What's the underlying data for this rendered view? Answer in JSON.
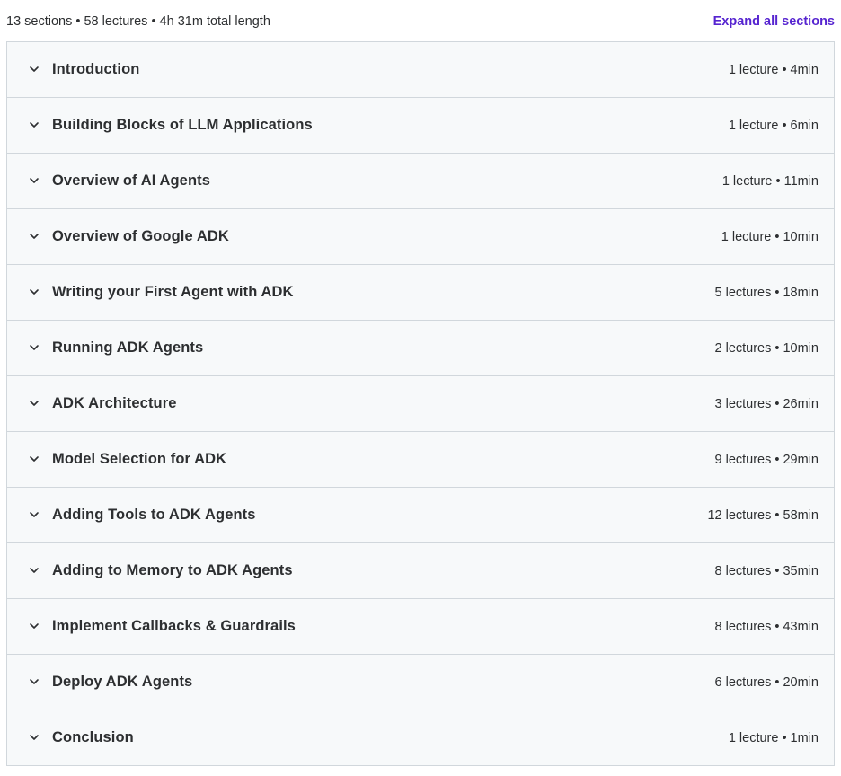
{
  "header": {
    "summary": "13 sections • 58 lectures • 4h 31m total length",
    "expand_label": "Expand all sections"
  },
  "icons": {
    "section_toggle": "chevron-down-icon"
  },
  "colors": {
    "accent": "#5624d0",
    "row_background": "#f7f9fa",
    "border": "#d1d7dc",
    "text": "#2d2f31"
  },
  "sections": [
    {
      "title": "Introduction",
      "meta": "1 lecture • 4min"
    },
    {
      "title": "Building Blocks of LLM Applications",
      "meta": "1 lecture • 6min"
    },
    {
      "title": "Overview of AI Agents",
      "meta": "1 lecture • 11min"
    },
    {
      "title": "Overview of Google ADK",
      "meta": "1 lecture • 10min"
    },
    {
      "title": "Writing your First Agent with ADK",
      "meta": "5 lectures • 18min"
    },
    {
      "title": "Running ADK Agents",
      "meta": "2 lectures • 10min"
    },
    {
      "title": "ADK Architecture",
      "meta": "3 lectures • 26min"
    },
    {
      "title": "Model Selection for ADK",
      "meta": "9 lectures • 29min"
    },
    {
      "title": "Adding Tools to ADK Agents",
      "meta": "12 lectures • 58min"
    },
    {
      "title": "Adding to Memory to ADK Agents",
      "meta": "8 lectures • 35min"
    },
    {
      "title": "Implement Callbacks & Guardrails",
      "meta": "8 lectures • 43min"
    },
    {
      "title": "Deploy ADK Agents",
      "meta": "6 lectures • 20min"
    },
    {
      "title": "Conclusion",
      "meta": "1 lecture • 1min"
    }
  ]
}
